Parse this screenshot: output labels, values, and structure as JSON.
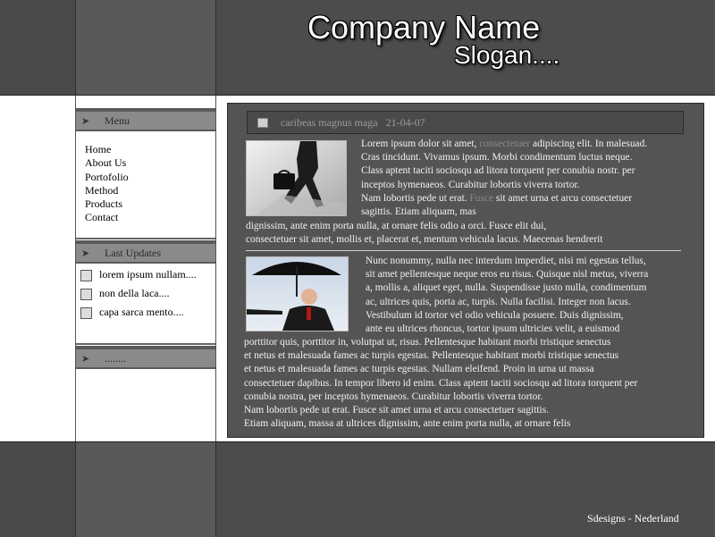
{
  "header": {
    "company_name": "Company Name",
    "slogan": "Slogan...."
  },
  "sidebar": {
    "menu_title": "Menu",
    "menu_items": [
      "Home",
      "About Us",
      "Portofolio",
      "Method",
      "Products",
      "Contact"
    ],
    "updates_title": "Last Updates",
    "updates": [
      "lorem ipsum nullam....",
      "non della laca....",
      "capa sarca mento...."
    ],
    "third_title": "........"
  },
  "article": {
    "title": "caribeas magnus maga",
    "date": "21-04-07",
    "p1_lines": [
      {
        "a": "Lorem ipsum dolor sit amet, ",
        "dim": "consectetuer",
        "b": " adipiscing elit. In malesuad."
      },
      {
        "a": "Cras tincidunt. Vivamus ipsum. Morbi condimentum luctus neque."
      },
      {
        "a": "Class aptent taciti sociosqu ad litora torquent per conubia nostr. per"
      },
      {
        "a": "inceptos hymenaeos. Curabitur lobortis viverra tortor."
      },
      {
        "a": "Nam lobortis pede ut erat. ",
        "dim": "Fusce",
        "b": " sit amet urna et arcu consectetuer"
      },
      {
        "a": " sagittis. Etiam aliquam, mas"
      }
    ],
    "p1_full_lines": [
      "dignissim, ante enim porta nulla, at ornare felis odio a orci. Fusce elit dui,",
      "consectetuer sit amet, mollis et, placerat et, mentum vehicula lacus. Maecenas hendrerit"
    ],
    "p2_lines": [
      "Nunc nonummy, nulla nec interdum imperdiet, nisi mi egestas tellus,",
      "sit amet pellentesque neque eros eu risus. Quisque nisl metus, viverra",
      "a, mollis a, aliquet eget, nulla. Suspendisse justo nulla, condimentum",
      "ac, ultrices quis, porta ac, turpis. Nulla facilisi. Integer non lacus.",
      "Vestibulum id tortor vel odio vehicula posuere. Duis dignissim,",
      "ante eu ultrices rhoncus, tortor ipsum ultricies velit, a euismod"
    ],
    "p2_full_lines": [
      "porttitor quis, porttitor in, volutpat ut, risus. Pellentesque habitant morbi tristique senectus",
      "et netus et malesuada fames ac turpis egestas. Pellentesque habitant morbi tristique senectus",
      "et netus et malesuada fames ac turpis egestas. Nullam eleifend. Proin in urna ut massa",
      "consectetuer dapibus. In tempor libero id enim. Class aptent taciti sociosqu ad litora torquent per",
      "conubia nostra, per inceptos hymenaeos. Curabitur lobortis viverra tortor.",
      "Nam lobortis pede ut erat. Fusce sit amet urna et arcu consectetuer sagittis.",
      "Etiam aliquam, massa at ultrices dignissim, ante enim porta nulla, at ornare felis"
    ]
  },
  "footer": {
    "credit": "Sdesigns - Nederland"
  },
  "colors": {
    "band": "#444444",
    "panel": "#545454",
    "sidehead": "#8a8a8a"
  }
}
